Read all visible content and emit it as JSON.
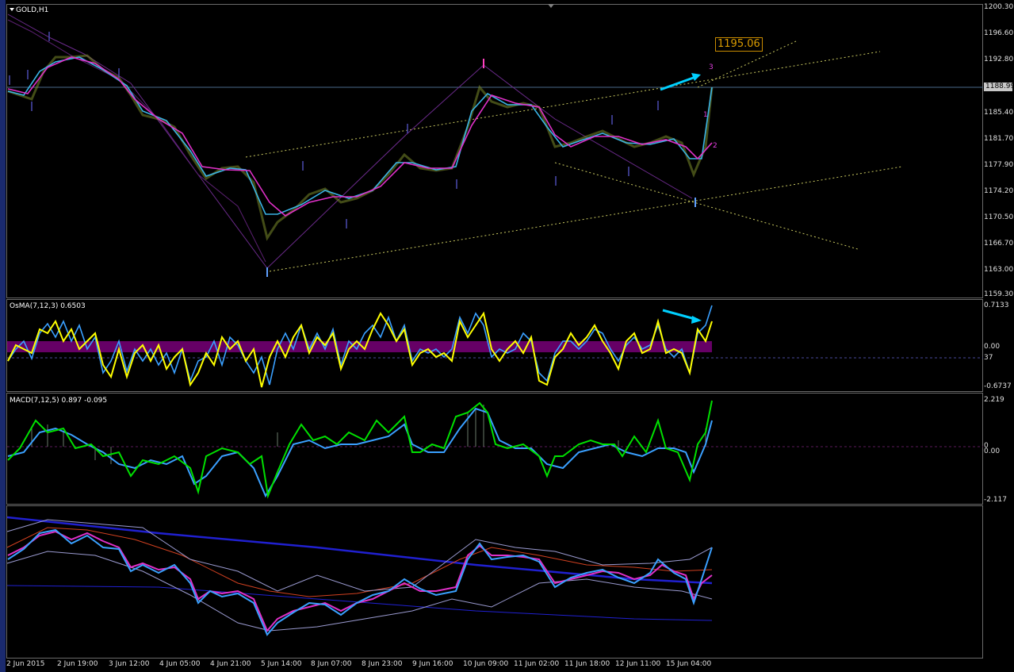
{
  "main_chart": {
    "title": "GOLD,H1",
    "price_scale": [
      "1200.30",
      "1196.60",
      "1192.80",
      "1185.40",
      "1181.70",
      "1177.90",
      "1174.20",
      "1170.50",
      "1166.70",
      "1163.00",
      "1159.30"
    ],
    "current_price": "1188.99",
    "target_price": "1195.06",
    "wave_labels": [
      "3",
      "1",
      "2"
    ]
  },
  "osma": {
    "label": "OsMA(7,12,3) 0.6503",
    "scale": [
      "0.7133",
      "0.00",
      "-0.6737"
    ],
    "level_label": "37"
  },
  "macd": {
    "label": "MACD(7,12,5) 0.897 -0.095",
    "scale": [
      "2.219",
      "0",
      "0.00",
      "-2.117"
    ]
  },
  "time_axis": [
    "2 Jun 2015",
    "2 Jun 19:00",
    "3 Jun 12:00",
    "4 Jun 05:00",
    "4 Jun 21:00",
    "5 Jun 14:00",
    "8 Jun 07:00",
    "8 Jun 23:00",
    "9 Jun 16:00",
    "10 Jun 09:00",
    "11 Jun 02:00",
    "11 Jun 18:00",
    "12 Jun 11:00",
    "15 Jun 04:00"
  ],
  "colors": {
    "background": "#000000",
    "ma_fast": "#3ab4e6",
    "ma_slow": "#e030c8",
    "osma_line": "#ffff00",
    "osma_hist": "#800080",
    "macd_line": "#00e000",
    "macd_signal": "#3aa0ff",
    "arrow": "#00d0ff"
  }
}
